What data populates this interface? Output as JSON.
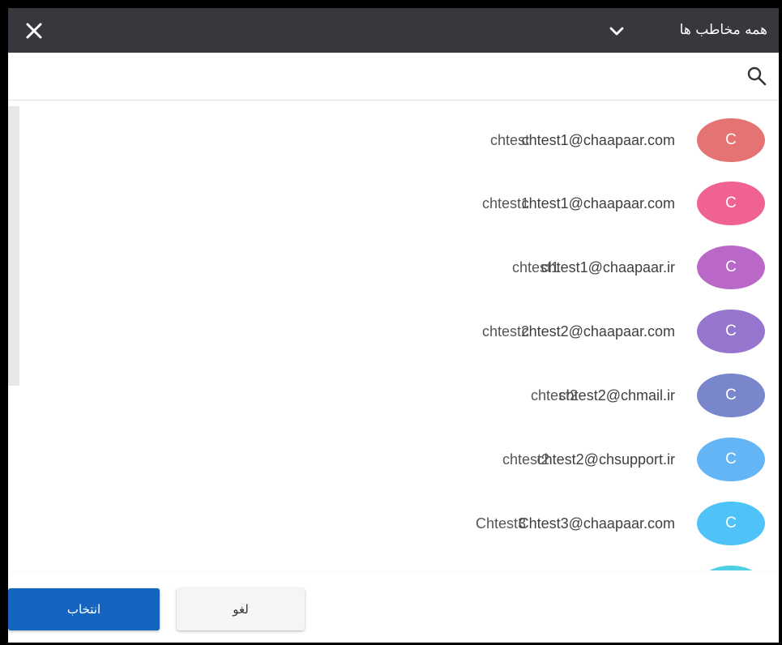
{
  "header": {
    "title": "همه مخاطب ها",
    "close_icon": "close-icon",
    "dropdown_icon": "chevron-down-icon"
  },
  "search": {
    "placeholder": "",
    "value": "",
    "icon": "search-icon"
  },
  "contacts": [
    {
      "initial": "C",
      "email": "chtest1@chaapaar.com",
      "name": "chtest",
      "color": "#e57373"
    },
    {
      "initial": "C",
      "email": "chtest1@chaapaar.com",
      "name": "chtest1",
      "color": "#f06292"
    },
    {
      "initial": "C",
      "email": "chtest1@chaapaar.ir",
      "name": "chtest1",
      "color": "#ba68c8"
    },
    {
      "initial": "C",
      "email": "chtest2@chaapaar.com",
      "name": "chtest2",
      "color": "#9575cd"
    },
    {
      "initial": "C",
      "email": "chtest2@chmail.ir",
      "name": "chtest2",
      "color": "#7986cb"
    },
    {
      "initial": "C",
      "email": "chtest2@chsupport.ir",
      "name": "chtest2",
      "color": "#64b5f6"
    },
    {
      "initial": "C",
      "email": "Chtest3@chaapaar.com",
      "name": "Chtest3",
      "color": "#4fc3f7"
    },
    {
      "initial": "",
      "email": "",
      "name": "",
      "color": "#4dd0e1"
    }
  ],
  "footer": {
    "select_label": "انتخاب",
    "cancel_label": "لغو"
  }
}
